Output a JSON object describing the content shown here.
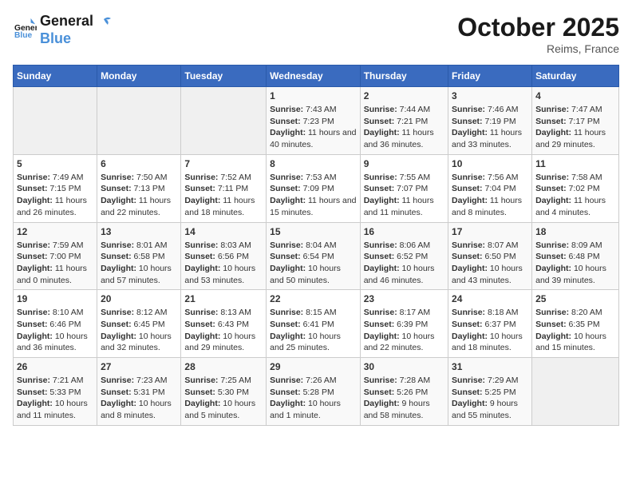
{
  "header": {
    "logo_line1": "General",
    "logo_line2": "Blue",
    "month": "October 2025",
    "location": "Reims, France"
  },
  "days_of_week": [
    "Sunday",
    "Monday",
    "Tuesday",
    "Wednesday",
    "Thursday",
    "Friday",
    "Saturday"
  ],
  "weeks": [
    [
      {
        "day": "",
        "content": ""
      },
      {
        "day": "",
        "content": ""
      },
      {
        "day": "",
        "content": ""
      },
      {
        "day": "1",
        "content": "Sunrise: 7:43 AM\nSunset: 7:23 PM\nDaylight: 11 hours and 40 minutes."
      },
      {
        "day": "2",
        "content": "Sunrise: 7:44 AM\nSunset: 7:21 PM\nDaylight: 11 hours and 36 minutes."
      },
      {
        "day": "3",
        "content": "Sunrise: 7:46 AM\nSunset: 7:19 PM\nDaylight: 11 hours and 33 minutes."
      },
      {
        "day": "4",
        "content": "Sunrise: 7:47 AM\nSunset: 7:17 PM\nDaylight: 11 hours and 29 minutes."
      }
    ],
    [
      {
        "day": "5",
        "content": "Sunrise: 7:49 AM\nSunset: 7:15 PM\nDaylight: 11 hours and 26 minutes."
      },
      {
        "day": "6",
        "content": "Sunrise: 7:50 AM\nSunset: 7:13 PM\nDaylight: 11 hours and 22 minutes."
      },
      {
        "day": "7",
        "content": "Sunrise: 7:52 AM\nSunset: 7:11 PM\nDaylight: 11 hours and 18 minutes."
      },
      {
        "day": "8",
        "content": "Sunrise: 7:53 AM\nSunset: 7:09 PM\nDaylight: 11 hours and 15 minutes."
      },
      {
        "day": "9",
        "content": "Sunrise: 7:55 AM\nSunset: 7:07 PM\nDaylight: 11 hours and 11 minutes."
      },
      {
        "day": "10",
        "content": "Sunrise: 7:56 AM\nSunset: 7:04 PM\nDaylight: 11 hours and 8 minutes."
      },
      {
        "day": "11",
        "content": "Sunrise: 7:58 AM\nSunset: 7:02 PM\nDaylight: 11 hours and 4 minutes."
      }
    ],
    [
      {
        "day": "12",
        "content": "Sunrise: 7:59 AM\nSunset: 7:00 PM\nDaylight: 11 hours and 0 minutes."
      },
      {
        "day": "13",
        "content": "Sunrise: 8:01 AM\nSunset: 6:58 PM\nDaylight: 10 hours and 57 minutes."
      },
      {
        "day": "14",
        "content": "Sunrise: 8:03 AM\nSunset: 6:56 PM\nDaylight: 10 hours and 53 minutes."
      },
      {
        "day": "15",
        "content": "Sunrise: 8:04 AM\nSunset: 6:54 PM\nDaylight: 10 hours and 50 minutes."
      },
      {
        "day": "16",
        "content": "Sunrise: 8:06 AM\nSunset: 6:52 PM\nDaylight: 10 hours and 46 minutes."
      },
      {
        "day": "17",
        "content": "Sunrise: 8:07 AM\nSunset: 6:50 PM\nDaylight: 10 hours and 43 minutes."
      },
      {
        "day": "18",
        "content": "Sunrise: 8:09 AM\nSunset: 6:48 PM\nDaylight: 10 hours and 39 minutes."
      }
    ],
    [
      {
        "day": "19",
        "content": "Sunrise: 8:10 AM\nSunset: 6:46 PM\nDaylight: 10 hours and 36 minutes."
      },
      {
        "day": "20",
        "content": "Sunrise: 8:12 AM\nSunset: 6:45 PM\nDaylight: 10 hours and 32 minutes."
      },
      {
        "day": "21",
        "content": "Sunrise: 8:13 AM\nSunset: 6:43 PM\nDaylight: 10 hours and 29 minutes."
      },
      {
        "day": "22",
        "content": "Sunrise: 8:15 AM\nSunset: 6:41 PM\nDaylight: 10 hours and 25 minutes."
      },
      {
        "day": "23",
        "content": "Sunrise: 8:17 AM\nSunset: 6:39 PM\nDaylight: 10 hours and 22 minutes."
      },
      {
        "day": "24",
        "content": "Sunrise: 8:18 AM\nSunset: 6:37 PM\nDaylight: 10 hours and 18 minutes."
      },
      {
        "day": "25",
        "content": "Sunrise: 8:20 AM\nSunset: 6:35 PM\nDaylight: 10 hours and 15 minutes."
      }
    ],
    [
      {
        "day": "26",
        "content": "Sunrise: 7:21 AM\nSunset: 5:33 PM\nDaylight: 10 hours and 11 minutes."
      },
      {
        "day": "27",
        "content": "Sunrise: 7:23 AM\nSunset: 5:31 PM\nDaylight: 10 hours and 8 minutes."
      },
      {
        "day": "28",
        "content": "Sunrise: 7:25 AM\nSunset: 5:30 PM\nDaylight: 10 hours and 5 minutes."
      },
      {
        "day": "29",
        "content": "Sunrise: 7:26 AM\nSunset: 5:28 PM\nDaylight: 10 hours and 1 minute."
      },
      {
        "day": "30",
        "content": "Sunrise: 7:28 AM\nSunset: 5:26 PM\nDaylight: 9 hours and 58 minutes."
      },
      {
        "day": "31",
        "content": "Sunrise: 7:29 AM\nSunset: 5:25 PM\nDaylight: 9 hours and 55 minutes."
      },
      {
        "day": "",
        "content": ""
      }
    ]
  ]
}
